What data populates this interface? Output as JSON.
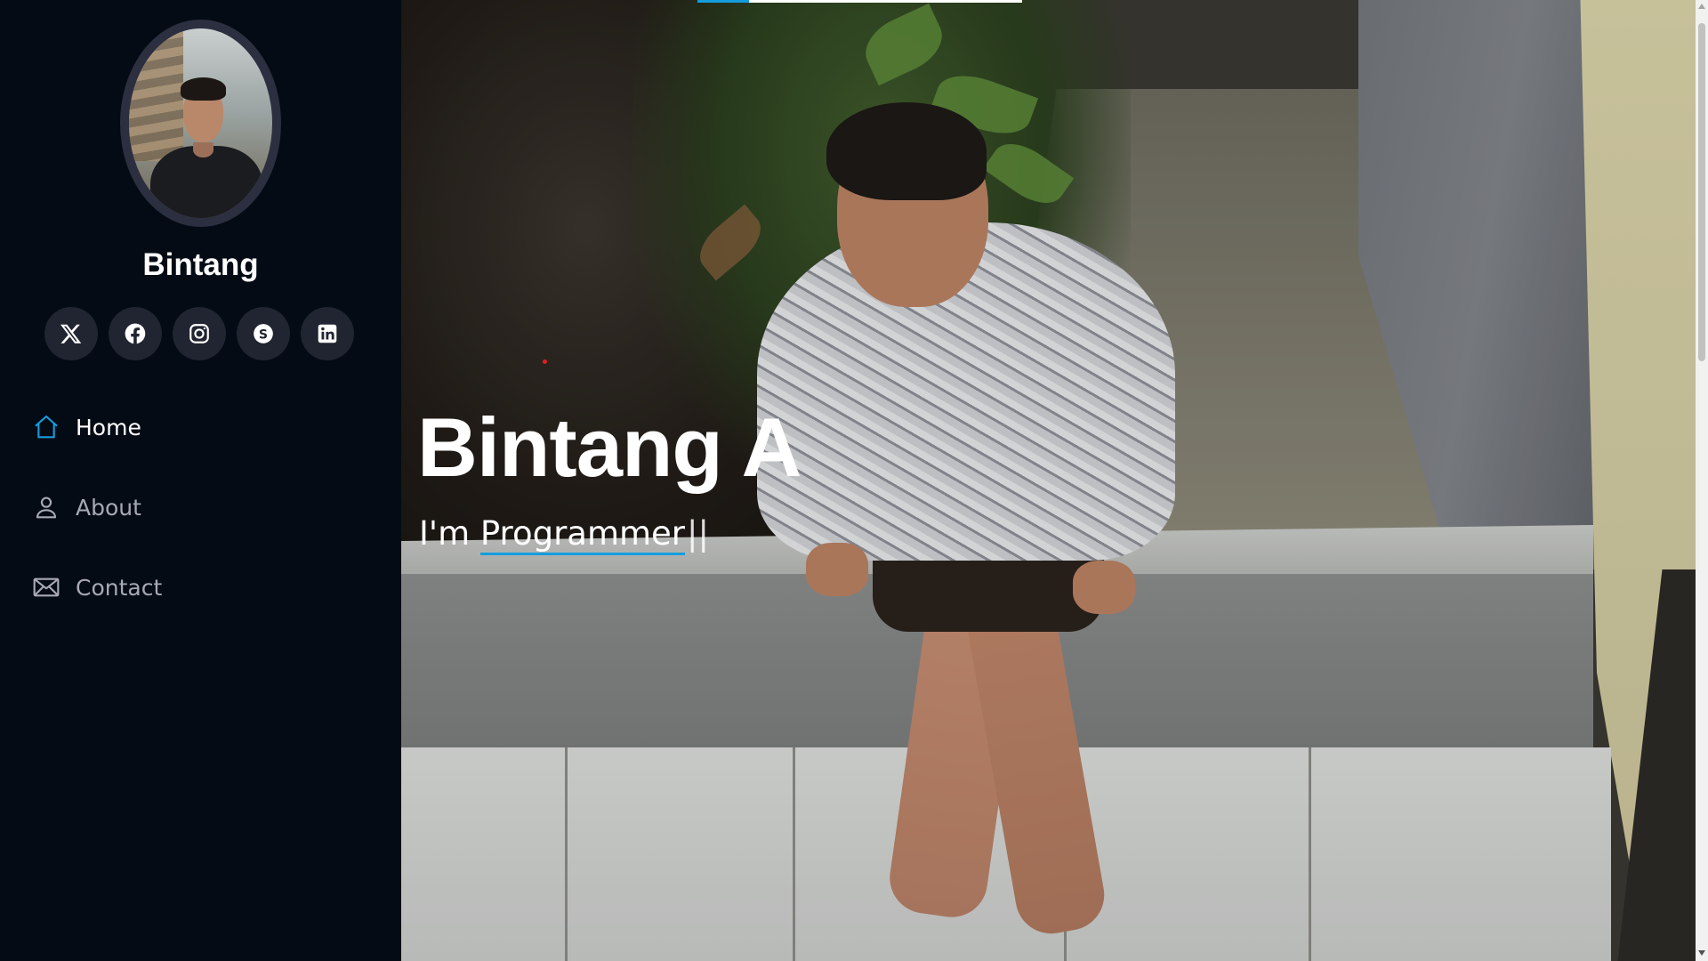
{
  "profile": {
    "name": "Bintang",
    "avatar_alt": "profile photo"
  },
  "socials": [
    {
      "name": "x-twitter-icon"
    },
    {
      "name": "facebook-icon"
    },
    {
      "name": "instagram-icon"
    },
    {
      "name": "skype-icon"
    },
    {
      "name": "linkedin-icon"
    }
  ],
  "nav": {
    "items": [
      {
        "label": "Home",
        "icon": "home-icon",
        "active": true
      },
      {
        "label": "About",
        "icon": "person-icon",
        "active": false
      },
      {
        "label": "Contact",
        "icon": "envelope-icon",
        "active": false
      }
    ]
  },
  "hero": {
    "title": "Bintang A",
    "subtitle_prefix": "I'm ",
    "typed_text": "Programmer",
    "cursor": "||"
  },
  "progress": {
    "fraction": 0.16
  },
  "colors": {
    "accent": "#149ddd",
    "sidebar_bg": "#040b14",
    "social_bg": "#212431",
    "nav_text": "#a8a9b4",
    "active_text": "#ffffff"
  }
}
